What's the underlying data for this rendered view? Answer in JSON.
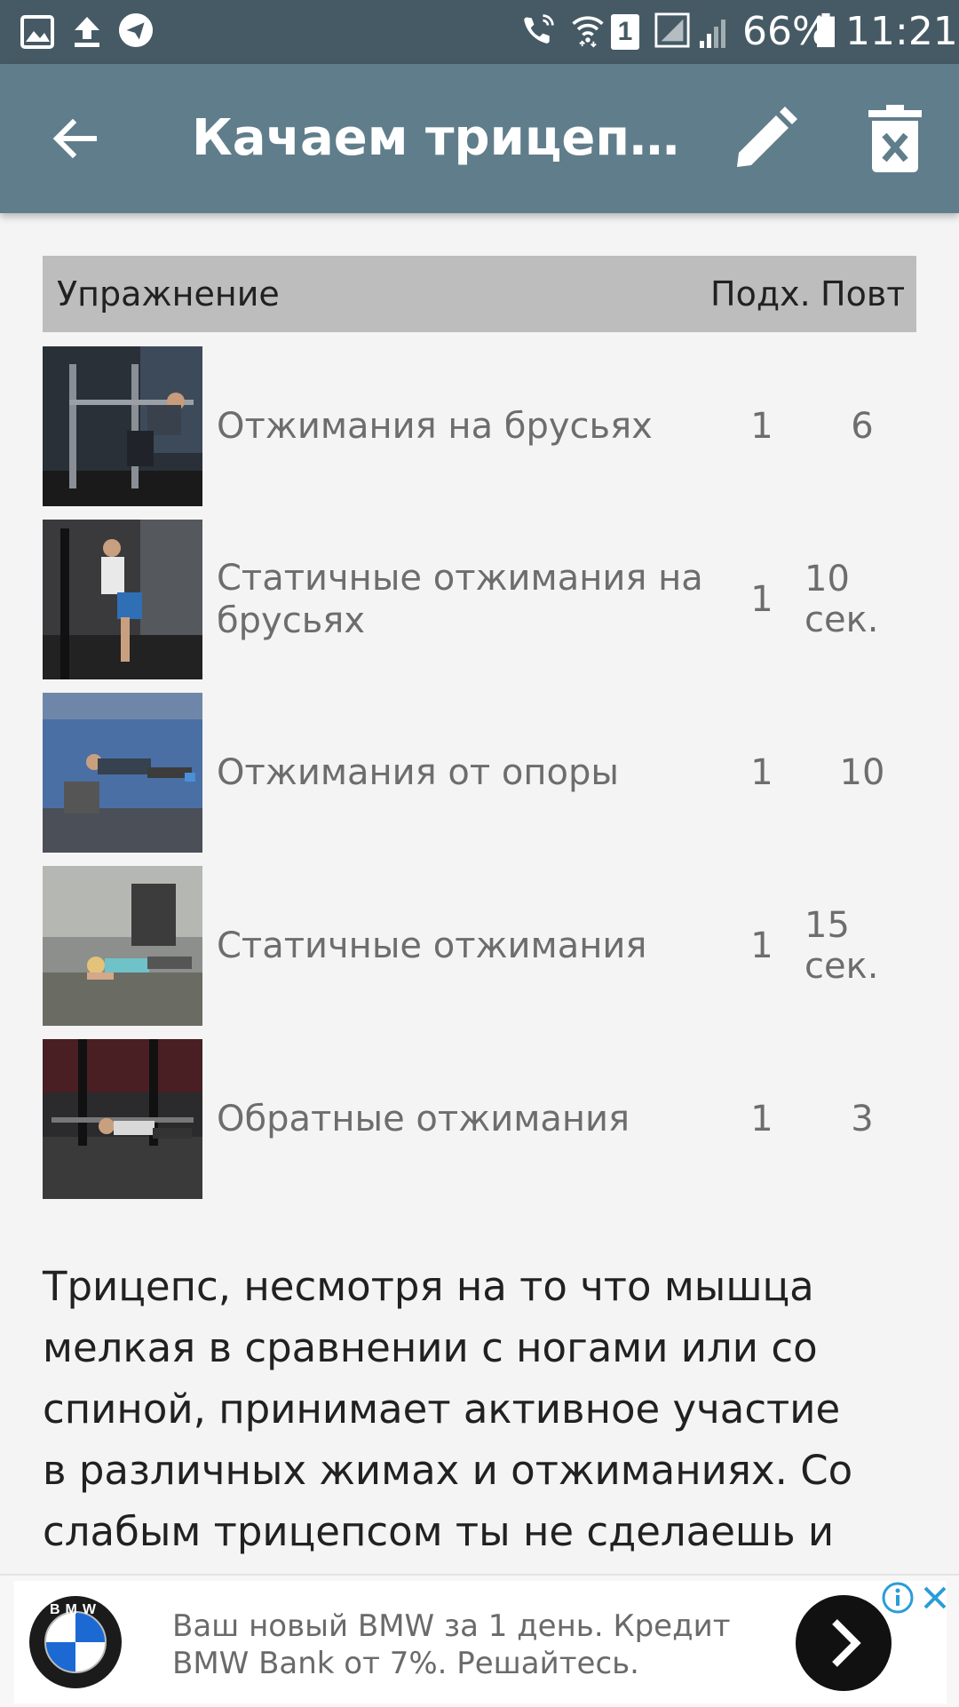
{
  "status_bar": {
    "battery": "66%",
    "time": "11:21",
    "sim": "1",
    "left_icons": [
      "image-icon",
      "upload-icon",
      "telegram-icon"
    ],
    "right_icons": [
      "wifi-call-icon",
      "wifi-icon",
      "sim-icon",
      "signal-icon",
      "signal-icon",
      "battery-icon"
    ]
  },
  "toolbar": {
    "title": "Качаем трицепс на брусьях",
    "back_icon": "arrow-back-icon",
    "edit_icon": "pencil-icon",
    "delete_icon": "trash-icon",
    "color": "#607d8b"
  },
  "table": {
    "headers": {
      "exercise": "Упражнение",
      "sets": "Подх.",
      "reps": "Повт"
    },
    "rows": [
      {
        "name": "Отжимания на брусьях",
        "sets": "1",
        "reps": "6"
      },
      {
        "name": "Статичные отжимания на брусьях",
        "sets": "1",
        "reps": "10 сек."
      },
      {
        "name": "Отжимания от опоры",
        "sets": "1",
        "reps": "10"
      },
      {
        "name": "Статичные отжимания",
        "sets": "1",
        "reps": "15 сек."
      },
      {
        "name": "Обратные отжимания",
        "sets": "1",
        "reps": "3"
      }
    ]
  },
  "description": "Трицепс, несмотря на то что мышца мелкая в сравнении с ногами или со спиной, принимает активное участие в различных жимах и отжиманиях. Со слабым трицепсом ты не сделаешь и",
  "ad": {
    "line1": "Ваш новый BMW за 1 день. Кредит",
    "line2": "BMW Bank от 7%. Решайтесь.",
    "logo_text": "BMW",
    "info_icon": "info-icon",
    "close_icon": "close-icon",
    "cta_icon": "chevron-right-icon"
  }
}
